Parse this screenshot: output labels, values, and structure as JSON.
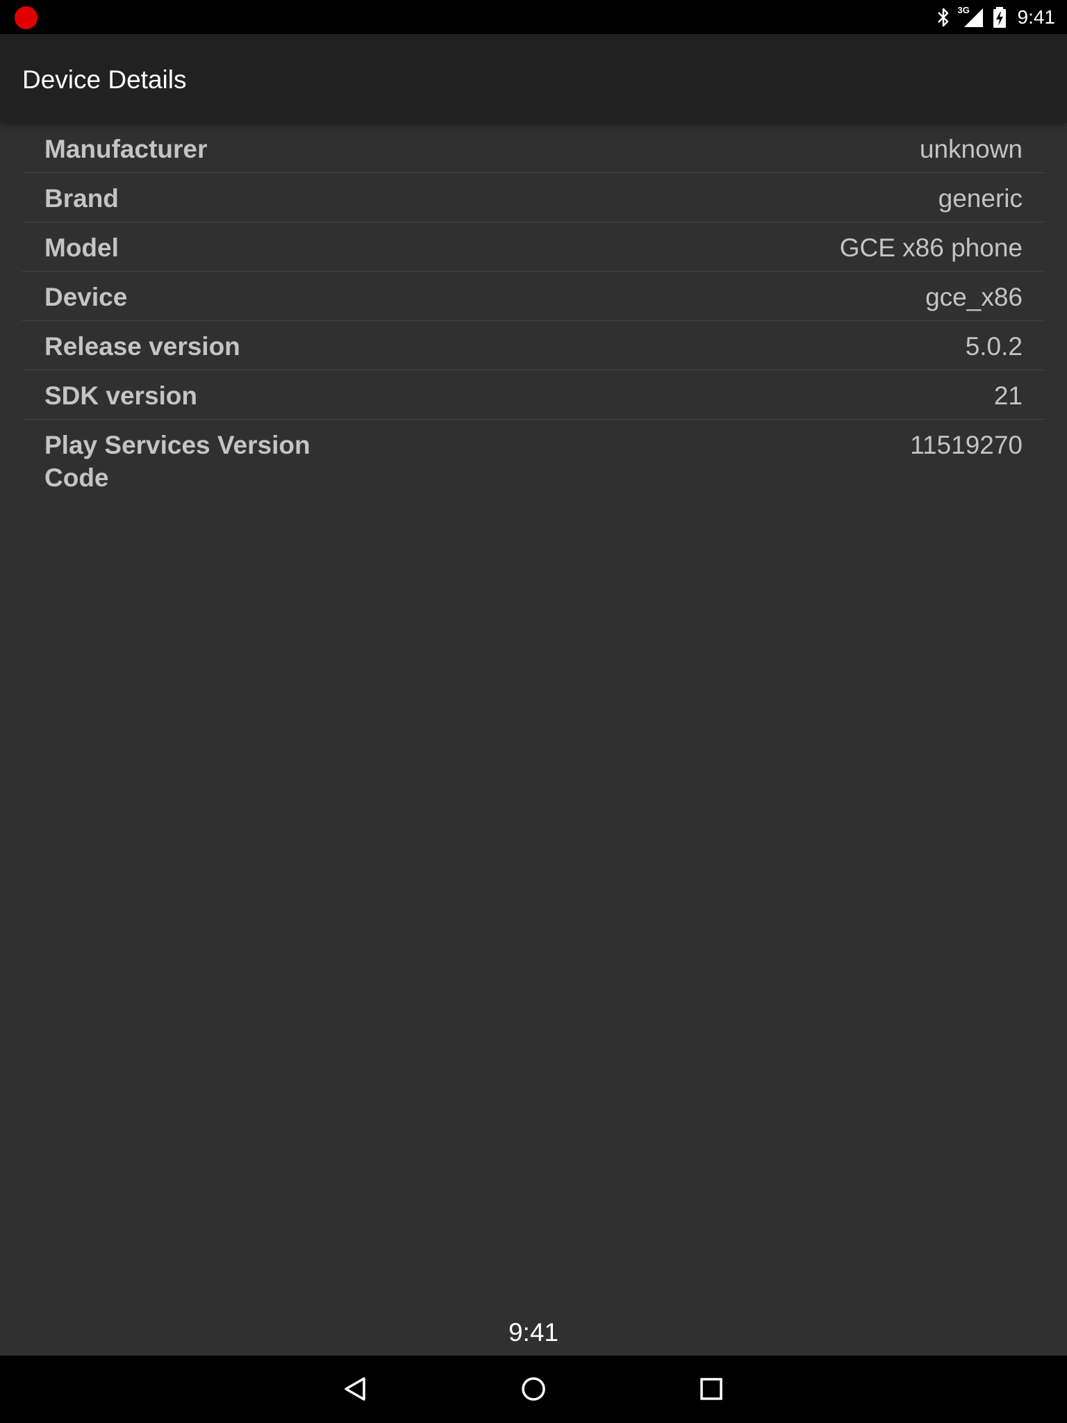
{
  "status_bar": {
    "time": "9:41",
    "network_label": "3G",
    "icons": [
      "record-icon",
      "bluetooth-icon",
      "signal-icon",
      "battery-charging-icon"
    ],
    "record_color": "#e00000"
  },
  "app_bar": {
    "title": "Device Details"
  },
  "details": [
    {
      "label": "Manufacturer",
      "value": "unknown"
    },
    {
      "label": "Brand",
      "value": "generic"
    },
    {
      "label": "Model",
      "value": "GCE x86 phone"
    },
    {
      "label": "Device",
      "value": "gce_x86"
    },
    {
      "label": "Release version",
      "value": "5.0.2"
    },
    {
      "label": "SDK version",
      "value": "21"
    },
    {
      "label": "Play Services Version Code",
      "value": "11519270"
    }
  ],
  "clock": "9:41",
  "nav_bar": {
    "icons": [
      "back-icon",
      "home-icon",
      "recents-icon"
    ]
  }
}
